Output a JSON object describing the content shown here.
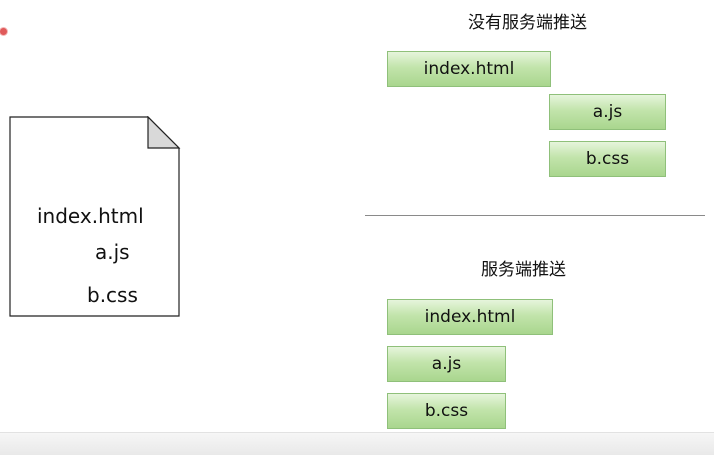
{
  "document": {
    "lines": [
      "index.html",
      "a.js",
      "b.css"
    ]
  },
  "no_push": {
    "title": "没有服务端推送",
    "files": [
      "index.html",
      "a.js",
      "b.css"
    ]
  },
  "push": {
    "title": "服务端推送",
    "files": [
      "index.html",
      "a.js",
      "b.css"
    ]
  },
  "colors": {
    "box_fill_top": "#e6f5dc",
    "box_fill_bottom": "#a9d68e",
    "box_border": "#8fc07a",
    "marker": "#e05a5a"
  }
}
